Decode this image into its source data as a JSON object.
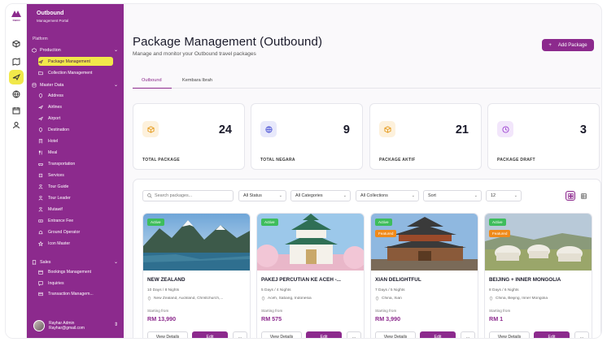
{
  "colors": {
    "brand": "#8c2a8d",
    "highlight": "#f1e84a",
    "active_badge": "#3ebd5c",
    "featured_badge": "#f08a1a"
  },
  "rail": {
    "logo_text": "SWAN",
    "icons": [
      "box-icon",
      "map-icon",
      "plane-icon",
      "globe-icon",
      "calendar-icon",
      "user-icon"
    ]
  },
  "sidebar": {
    "title": "Outbound",
    "subtitle": "Management Portal",
    "section_platform": "Platform",
    "production": "Production",
    "production_items": [
      "Package Management",
      "Collection Management"
    ],
    "master_data": "Master Data",
    "master_items": [
      "Address",
      "Airlines",
      "Airport",
      "Destination",
      "Hotel",
      "Meal",
      "Transportation",
      "Services",
      "Tour Guide",
      "Tour Leader",
      "Mutawif",
      "Entrance Fee",
      "Ground Operator",
      "Icon Master"
    ],
    "sales": "Sales",
    "sales_items": [
      "Bookings Management",
      "Inquiries",
      "Transaction Managem..."
    ],
    "user_name": "Rayhar Admin",
    "user_email": "Rayhar@gmail.com"
  },
  "header": {
    "title": "Package Management (Outbound)",
    "subtitle": "Manage and monitor your Outbound travel packages",
    "add_button": "Add Package"
  },
  "tabs": [
    "Outbound",
    "Kembara Ibrah"
  ],
  "stats": [
    {
      "value": "24",
      "label": "TOTAL PACKAGE",
      "icon": "box-icon"
    },
    {
      "value": "9",
      "label": "TOTAL NEGARA",
      "icon": "globe-icon"
    },
    {
      "value": "21",
      "label": "PACKAGE AKTIF",
      "icon": "box-icon"
    },
    {
      "value": "3",
      "label": "PACKAGE DRAFT",
      "icon": "clock-icon"
    }
  ],
  "filters": {
    "search_placeholder": "Search packages...",
    "status": "All Status",
    "category": "All Categories",
    "collection": "All Collections",
    "sort": "Sort",
    "per_page": "12"
  },
  "cards": [
    {
      "badges": [
        "Active"
      ],
      "name": "NEW ZEALAND",
      "duration": "10 Days / 8 Nights",
      "location": "New Zealand, Auckland, Christchurch,...",
      "from_label": "Starting from",
      "price": "RM 13,990"
    },
    {
      "badges": [
        "Active"
      ],
      "name": "PAKEJ PERCUTIAN KE ACEH -...",
      "duration": "5 Days / 4 Nights",
      "location": "Aceh, Sabang, Indonesia",
      "from_label": "Starting from",
      "price": "RM 575"
    },
    {
      "badges": [
        "Active",
        "Featured"
      ],
      "name": "XIAN DELIGHTFUL",
      "duration": "7 Days / 5 Nights",
      "location": "China, Xian",
      "from_label": "Starting from",
      "price": "RM 3,990"
    },
    {
      "badges": [
        "Active",
        "Featured"
      ],
      "name": "BEIJING + INNER MONGOLIA",
      "duration": "8 Days / 6 Nights",
      "location": "China, Beijing, Inner Mongolia",
      "from_label": "Starting from",
      "price": "RM 1"
    }
  ],
  "card_buttons": {
    "view": "View Details",
    "edit": "Edit",
    "more": "..."
  }
}
